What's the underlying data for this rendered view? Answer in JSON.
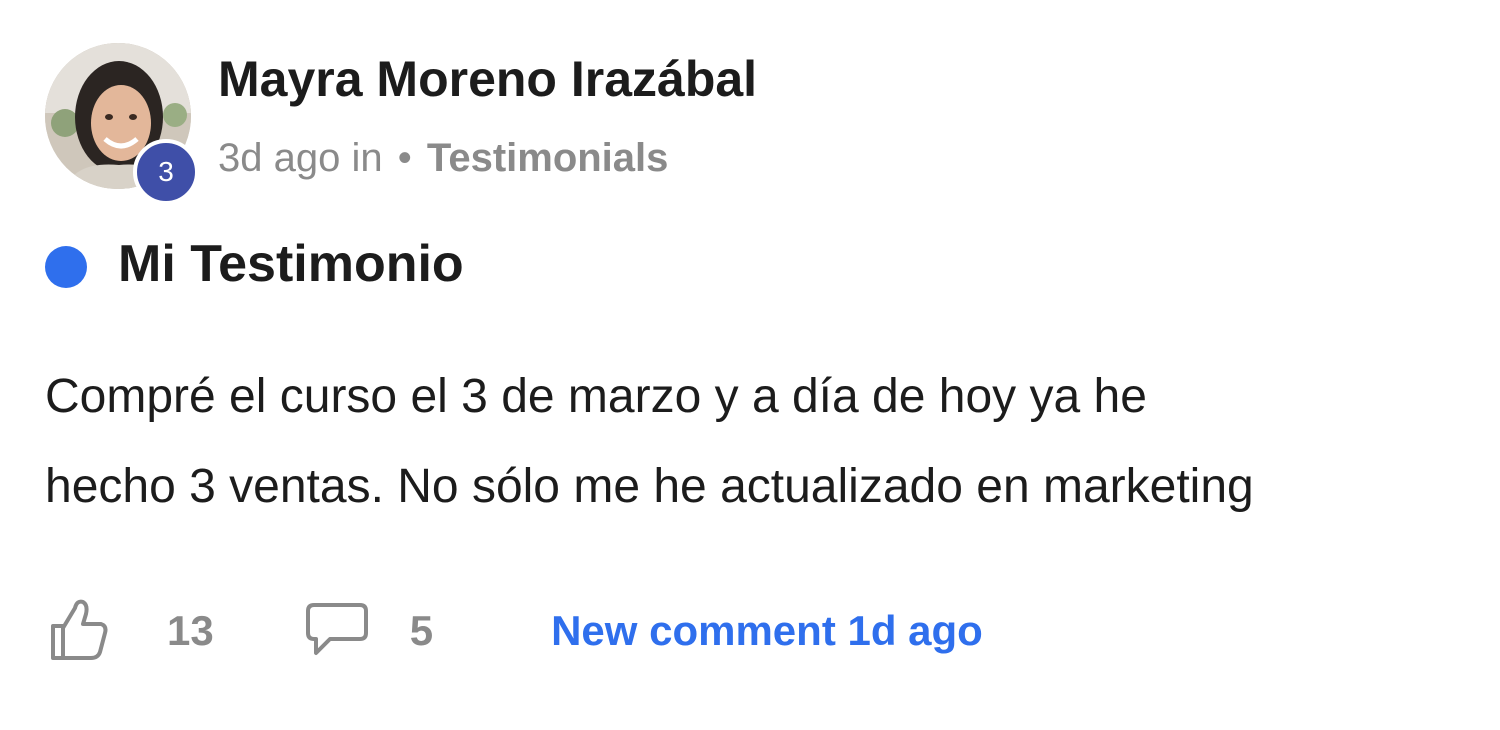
{
  "post": {
    "author": {
      "name": "Mayra Moreno Irazábal",
      "level": "3"
    },
    "meta": {
      "time": "3d ago in",
      "separator": "•",
      "category": "Testimonials"
    },
    "title": "Mi Testimonio",
    "body_lines": [
      "Compré el curso el 3 de marzo y a día de hoy ya he",
      "hecho 3 ventas. No sólo me he actualizado en marketing"
    ],
    "footer": {
      "likes": "13",
      "comments": "5",
      "new_comment": "New comment 1d ago"
    }
  },
  "icons": {
    "like": "thumbs-up-icon",
    "comment": "comment-bubble-icon"
  },
  "colors": {
    "accent_blue": "#2f6fed",
    "badge_indigo": "#3f4fa8",
    "muted_gray": "#8a8a8a",
    "text": "#1c1c1c"
  }
}
